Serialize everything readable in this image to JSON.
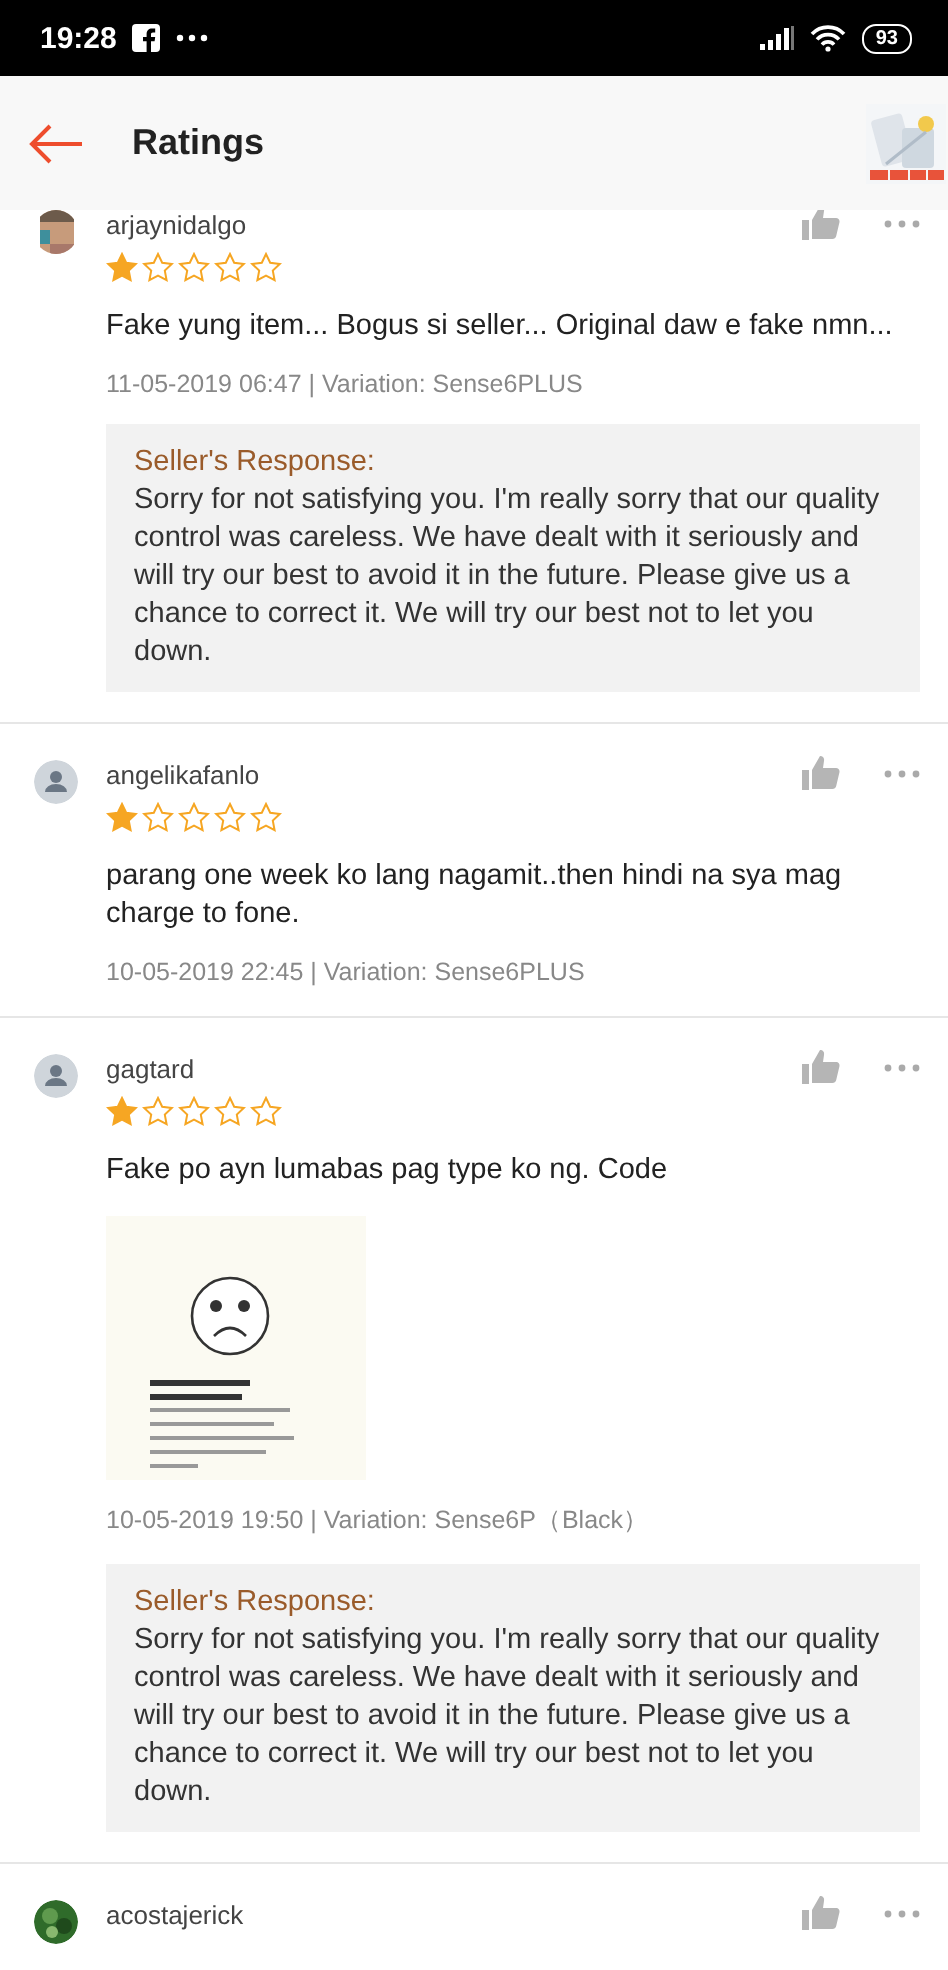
{
  "status_bar": {
    "time": "19:28",
    "battery": "93"
  },
  "header": {
    "title": "Ratings"
  },
  "reviews": [
    {
      "user": "arjaynidalgo",
      "stars": 1,
      "text": "Fake yung item... Bogus si seller... Original daw e fake nmn...",
      "meta": "11-05-2019 06:47 | Variation: Sense6PLUS",
      "response": {
        "title": "Seller's Response:",
        "text": "Sorry for not satisfying you. I'm really sorry that our quality control was careless. We have dealt with it seriously and will try our best to avoid it in the future. Please give us a chance to correct it. We will try our best not to let you down."
      }
    },
    {
      "user": "angelikafanlo",
      "avatar": {
        "kind": "default"
      },
      "stars": 1,
      "text": "parang one week ko lang nagamit..then hindi na sya mag charge to fone.",
      "meta": "10-05-2019 22:45 | Variation: Sense6PLUS"
    },
    {
      "user": "gagtard",
      "avatar": {
        "kind": "default"
      },
      "stars": 1,
      "text": "Fake po ayn lumabas pag type ko ng. Code",
      "meta": "10-05-2019 19:50 | Variation: Sense6P（Black）",
      "response": {
        "title": "Seller's Response:",
        "text": "Sorry for not satisfying you. I'm really sorry that our quality control was careless. We have dealt with it seriously and will try our best to avoid it in the future. Please give us a chance to correct it. We will try our best not to let you down."
      }
    },
    {
      "user": "acostajerick",
      "avatar": {
        "kind": "photo2"
      }
    }
  ]
}
